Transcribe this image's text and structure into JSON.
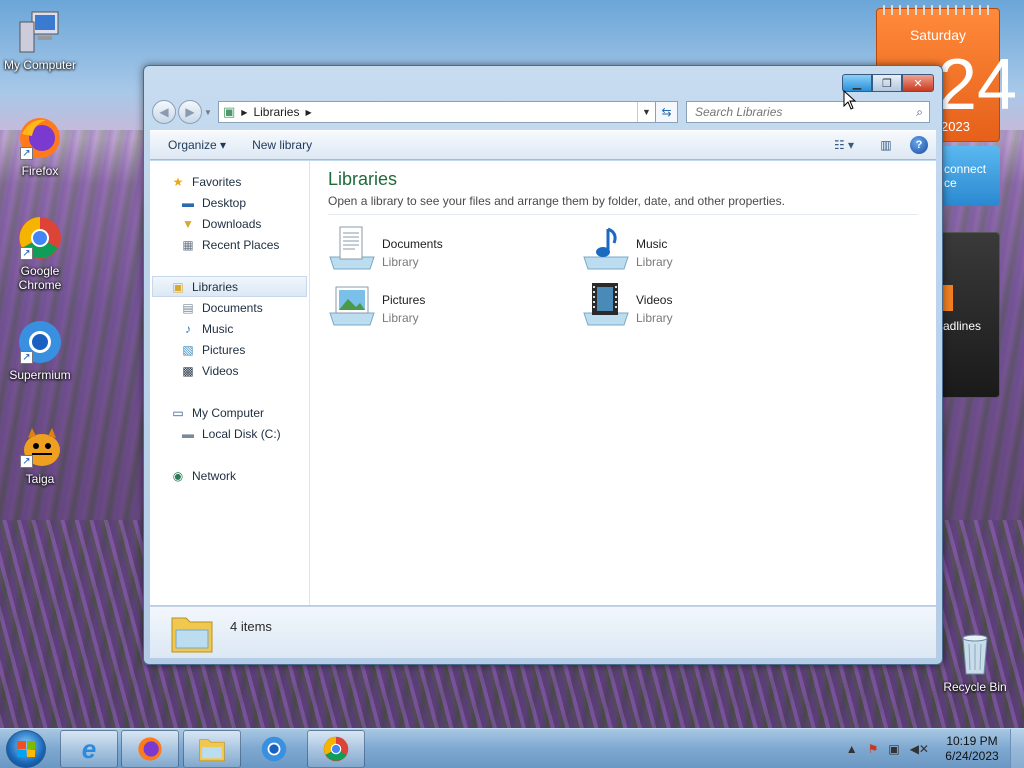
{
  "desktop": {
    "icons": [
      {
        "label": "My Computer"
      },
      {
        "label": "Firefox"
      },
      {
        "label": "Google Chrome"
      },
      {
        "label": "Supermium"
      },
      {
        "label": "Taiga"
      },
      {
        "label": "Recycle Bin"
      }
    ],
    "gadgets": {
      "calendar": {
        "day": "Saturday",
        "date": "24",
        "year": "2023"
      },
      "weather_text": "connect\nce",
      "feed_text": "adlines"
    }
  },
  "window": {
    "address": {
      "crumbs": [
        "Libraries"
      ]
    },
    "search": {
      "placeholder": "Search Libraries"
    },
    "toolbar": {
      "organize": "Organize ▾",
      "new_library": "New library"
    },
    "nav": {
      "favorites": "Favorites",
      "desktop": "Desktop",
      "downloads": "Downloads",
      "recent": "Recent Places",
      "libraries": "Libraries",
      "documents": "Documents",
      "music": "Music",
      "pictures": "Pictures",
      "videos": "Videos",
      "computer": "My Computer",
      "localdisk": "Local Disk (C:)",
      "network": "Network"
    },
    "content": {
      "title": "Libraries",
      "subtitle": "Open a library to see your files and arrange them by folder, date, and other properties.",
      "libraries": [
        {
          "name": "Documents",
          "type": "Library",
          "icon": "documents-library-icon"
        },
        {
          "name": "Music",
          "type": "Library",
          "icon": "music-library-icon"
        },
        {
          "name": "Pictures",
          "type": "Library",
          "icon": "pictures-library-icon"
        },
        {
          "name": "Videos",
          "type": "Library",
          "icon": "videos-library-icon"
        }
      ]
    },
    "details": {
      "count": "4 items"
    }
  },
  "taskbar": {
    "clock": {
      "time": "10:19 PM",
      "date": "6/24/2023"
    }
  },
  "colors": {
    "accent": "#1e6a3a",
    "taskbar": "#7ea8d0",
    "close": "#c83a20"
  }
}
